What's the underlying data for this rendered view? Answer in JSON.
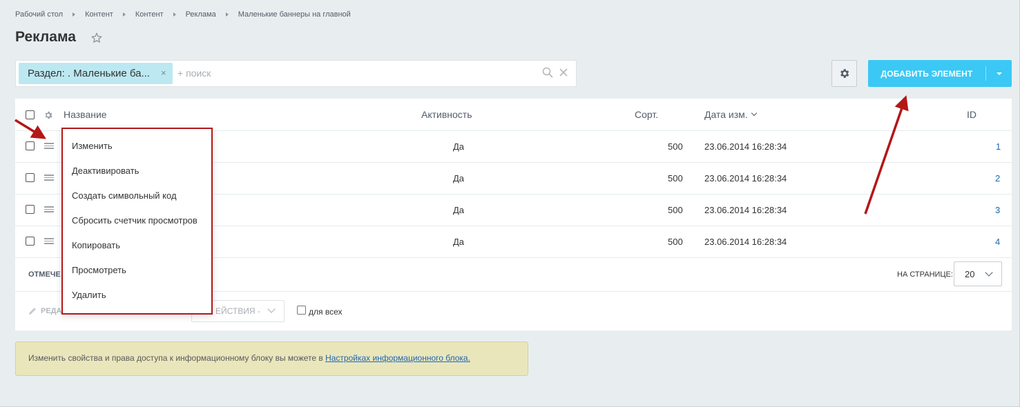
{
  "breadcrumb": [
    "Рабочий стол",
    "Контент",
    "Контент",
    "Реклама",
    "Маленькие баннеры на главной"
  ],
  "page": {
    "title": "Реклама"
  },
  "filter": {
    "tag_label": "Раздел: . Маленькие ба...",
    "tag_close": "×",
    "placeholder": "+ поиск"
  },
  "toolbar": {
    "add_button_label": "ДОБАВИТЬ ЭЛЕМЕНТ"
  },
  "grid": {
    "columns": {
      "name": "Название",
      "active": "Активность",
      "sort": "Сорт.",
      "date": "Дата изм.",
      "id": "ID"
    },
    "rows": [
      {
        "active": "Да",
        "sort": "500",
        "date": "23.06.2014 16:28:34",
        "id": "1"
      },
      {
        "active": "Да",
        "sort": "500",
        "date": "23.06.2014 16:28:34",
        "id": "2"
      },
      {
        "active": "Да",
        "sort": "500",
        "date": "23.06.2014 16:28:34",
        "id": "3"
      },
      {
        "active": "Да",
        "sort": "500",
        "date": "23.06.2014 16:28:34",
        "id": "4"
      }
    ],
    "footer": {
      "selected_label": "ОТМЕЧЕ",
      "per_page_label": "НА СТРАНИЦЕ:",
      "per_page_value": "20"
    },
    "action_bar": {
      "edit_label": "РЕДА",
      "actions_select": "ЕЙСТВИЯ -",
      "for_all_label": "для всех"
    }
  },
  "context_menu": {
    "items": [
      "Изменить",
      "Деактивировать",
      "Создать символьный код",
      "Сбросить счетчик просмотров",
      "Копировать",
      "Просмотреть",
      "Удалить"
    ]
  },
  "info": {
    "text": "Изменить свойства и права доступа к информационному блоку вы можете в ",
    "link": "Настройках информационного блока."
  },
  "colors": {
    "accent": "#3bc8f5",
    "annotation": "#b41718",
    "link": "#2067b0",
    "info_bg": "#eae6bc"
  }
}
